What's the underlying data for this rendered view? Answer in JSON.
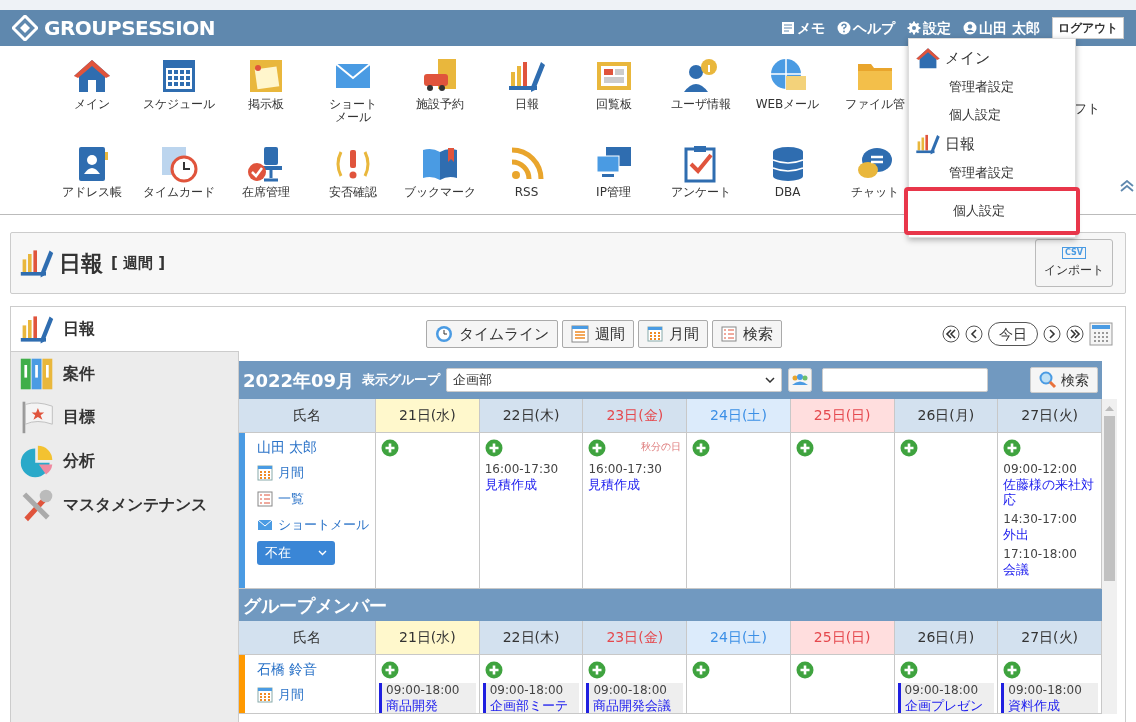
{
  "header": {
    "logo": "GROUPSESSION",
    "links": [
      {
        "label": "メモ",
        "kind": "memo"
      },
      {
        "label": "ヘルプ",
        "kind": "help"
      },
      {
        "label": "設定",
        "kind": "settings"
      },
      {
        "label": "山田 太郎",
        "kind": "user"
      }
    ],
    "logout": "ログアウト"
  },
  "apps": [
    [
      {
        "label": "メイン",
        "kind": "app"
      },
      {
        "label": "スケジュール",
        "kind": "app"
      },
      {
        "label": "掲示板",
        "kind": "app"
      },
      {
        "lines": [
          "ショート",
          "メール"
        ],
        "kind": "app"
      },
      {
        "label": "施設予約",
        "kind": "app"
      },
      {
        "label": "日報",
        "kind": "app"
      },
      {
        "label": "回覧板",
        "kind": "app"
      },
      {
        "label": "ユーザ情報",
        "kind": "app"
      },
      {
        "label": "WEBメール",
        "kind": "app"
      },
      {
        "label": "ファイル管",
        "kind": "app"
      },
      {
        "label": "フト",
        "kind": "label_only"
      }
    ],
    [
      {
        "label": "アドレス帳",
        "kind": "app"
      },
      {
        "label": "タイムカード",
        "kind": "app"
      },
      {
        "label": "在席管理",
        "kind": "app"
      },
      {
        "label": "安否確認",
        "kind": "app"
      },
      {
        "label": "ブックマーク",
        "kind": "app"
      },
      {
        "label": "RSS",
        "kind": "app"
      },
      {
        "label": "IP管理",
        "kind": "app"
      },
      {
        "label": "アンケート",
        "kind": "app"
      },
      {
        "label": "DBA",
        "kind": "app"
      },
      {
        "label": "チャット",
        "kind": "app"
      }
    ]
  ],
  "menu": {
    "sections": [
      {
        "title": "メイン",
        "items": [
          {
            "label": "管理者設定",
            "highlighted": false
          },
          {
            "label": "個人設定",
            "highlighted": false
          }
        ]
      },
      {
        "title": "日報",
        "items": [
          {
            "label": "管理者設定",
            "highlighted": false
          },
          {
            "label": "個人設定",
            "highlighted": true
          }
        ]
      }
    ]
  },
  "page_title": {
    "title": "日報",
    "view": "[ 週間 ]"
  },
  "import_button": {
    "badge": "CSV",
    "label": "インポート"
  },
  "sidebar": {
    "items": [
      {
        "label": "日報",
        "selected": true
      },
      {
        "label": "案件",
        "selected": false
      },
      {
        "label": "目標",
        "selected": false
      },
      {
        "label": "分析",
        "selected": false
      },
      {
        "label": "マスタメンテナンス",
        "selected": false
      }
    ]
  },
  "view_buttons": [
    {
      "label": "タイムライン"
    },
    {
      "label": "週間"
    },
    {
      "label": "月間"
    },
    {
      "label": "検索"
    }
  ],
  "nav": {
    "today": "今日"
  },
  "calendar": {
    "month": "2022年09月",
    "group_label": "表示グループ",
    "group": "企画部",
    "search_button": "検索",
    "user_header": {
      "name_header": "氏名",
      "days": [
        {
          "label": "21日(水)",
          "kind": "today"
        },
        {
          "label": "22日(木)",
          "kind": "weekday"
        },
        {
          "label": "23日(金)",
          "kind": "holiday"
        },
        {
          "label": "24日(土)",
          "kind": "saturday"
        },
        {
          "label": "25日(日)",
          "kind": "sunday"
        },
        {
          "label": "26日(月)",
          "kind": "weekday"
        },
        {
          "label": "27日(火)",
          "kind": "weekday"
        }
      ]
    },
    "user": {
      "name": "山田 太郎",
      "color": "#4a9be3",
      "links": [
        {
          "label": "月間",
          "kind": "month"
        },
        {
          "label": "一覧",
          "kind": "list"
        },
        {
          "label": "ショートメール",
          "kind": "mail"
        }
      ],
      "status": "不在",
      "cells": [
        {},
        {
          "entries": [
            {
              "time": "16:00-17:30",
              "title": "見積作成"
            }
          ]
        },
        {
          "holiday": "秋分の日",
          "entries": [
            {
              "time": "16:00-17:30",
              "title": "見積作成"
            }
          ]
        },
        {},
        {},
        {},
        {
          "entries": [
            {
              "time": "09:00-12:00",
              "title": "佐藤様の来社対応"
            },
            {
              "time": "14:30-17:00",
              "title": "外出"
            },
            {
              "time": "17:10-18:00",
              "title": "会議"
            }
          ]
        }
      ]
    },
    "section_title": "グループメンバー",
    "member_header": {
      "name_header": "氏名",
      "days": [
        {
          "label": "21日(水)",
          "kind": "today"
        },
        {
          "label": "22日(木)",
          "kind": "weekday"
        },
        {
          "label": "23日(金)",
          "kind": "holiday"
        },
        {
          "label": "24日(土)",
          "kind": "saturday"
        },
        {
          "label": "25日(日)",
          "kind": "sunday"
        },
        {
          "label": "26日(月)",
          "kind": "weekday"
        },
        {
          "label": "27日(火)",
          "kind": "weekday"
        }
      ]
    },
    "members": [
      {
        "name": "石橋 鈴音",
        "color": "#ff9900",
        "links": [
          {
            "label": "月間",
            "kind": "month"
          }
        ],
        "cells": [
          {
            "entries": [
              {
                "time": "09:00-18:00",
                "title": "商品開発"
              }
            ]
          },
          {
            "entries": [
              {
                "time": "09:00-18:00",
                "title": "企画部ミーテ"
              }
            ]
          },
          {
            "entries": [
              {
                "time": "09:00-18:00",
                "title": "商品開発会議"
              }
            ]
          },
          {},
          {},
          {
            "entries": [
              {
                "time": "09:00-18:00",
                "title": "企画プレゼン"
              }
            ]
          },
          {
            "entries": [
              {
                "time": "09:00-18:00",
                "title": "資料作成"
              }
            ]
          }
        ]
      }
    ]
  }
}
